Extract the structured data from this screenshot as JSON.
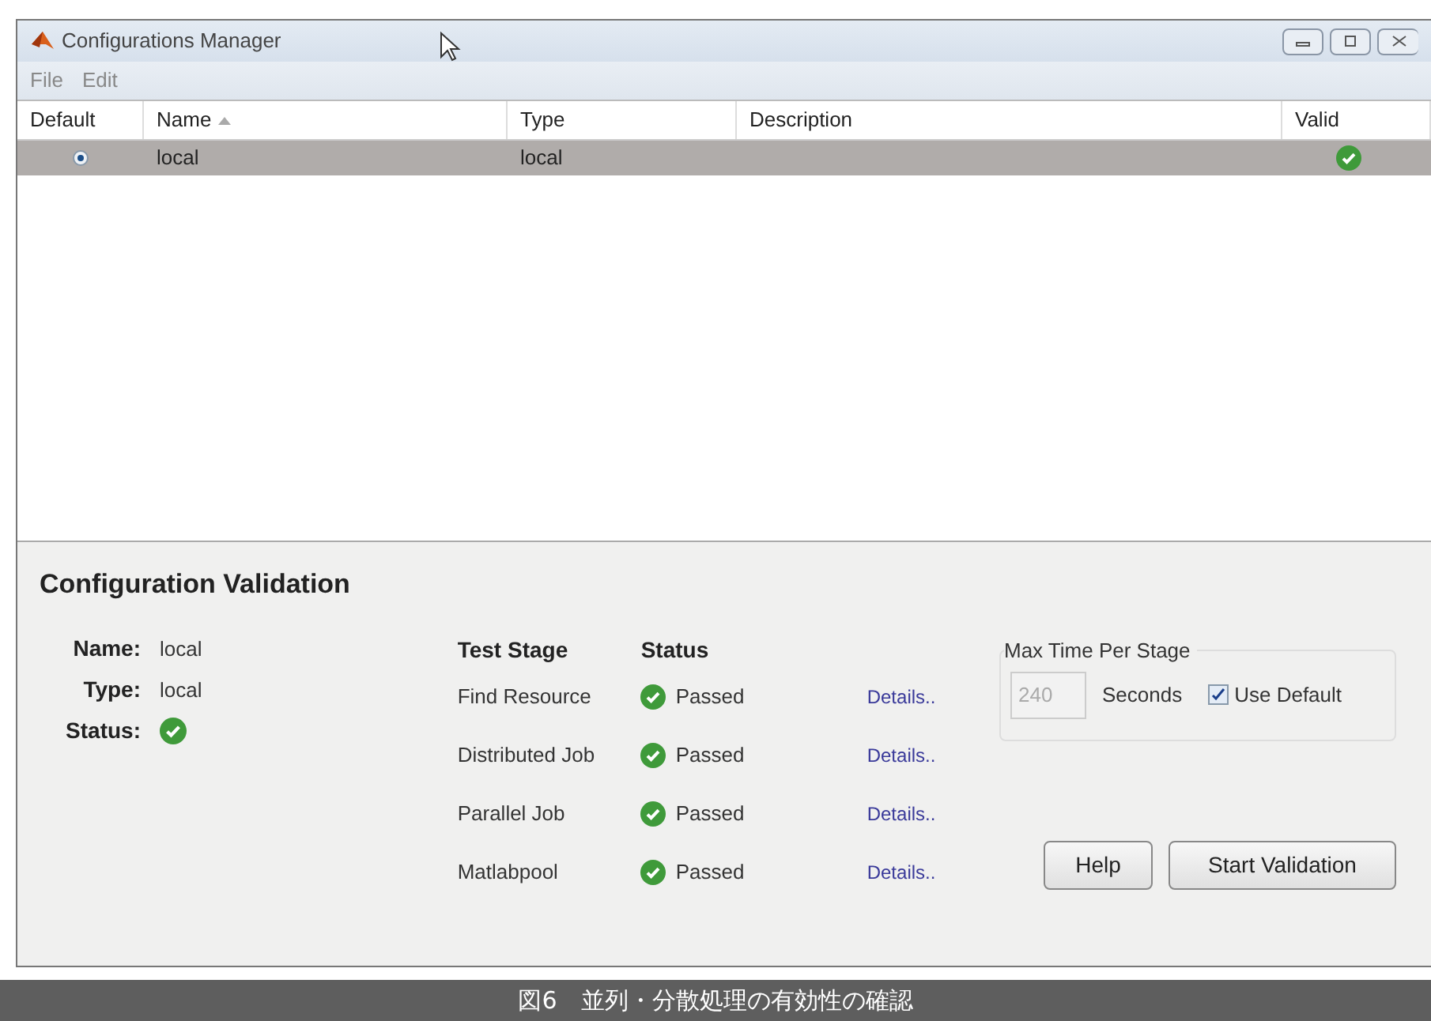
{
  "window": {
    "title": "Configurations Manager"
  },
  "menu": [
    "File",
    "Edit"
  ],
  "table": {
    "columns": [
      {
        "label": "Default",
        "sorted": false
      },
      {
        "label": "Name",
        "sorted": true
      },
      {
        "label": "Type",
        "sorted": false
      },
      {
        "label": "Description",
        "sorted": false
      },
      {
        "label": "Valid",
        "sorted": false
      }
    ],
    "rows": [
      {
        "default": true,
        "name": "local",
        "type": "local",
        "valid": true,
        "selected": true
      }
    ]
  },
  "validation": {
    "title": "Configuration Validation",
    "fields": [
      {
        "kind": "text",
        "label": "Name:",
        "value": "local"
      },
      {
        "kind": "text",
        "label": "Type:",
        "value": "local"
      },
      {
        "kind": "status",
        "label": "Status:",
        "passed": true
      }
    ],
    "stage_headers": [
      "Test Stage",
      "Status"
    ],
    "stages": [
      {
        "stage": "Find Resource",
        "passed": true,
        "status": "Passed",
        "link": "Details.."
      },
      {
        "stage": "Distributed Job",
        "passed": true,
        "status": "Passed",
        "link": "Details.."
      },
      {
        "stage": "Parallel Job",
        "passed": true,
        "status": "Passed",
        "link": "Details.."
      },
      {
        "stage": "Matlabpool",
        "passed": true,
        "status": "Passed",
        "link": "Details.."
      }
    ],
    "max_time": {
      "title": "Max Time Per Stage",
      "value": "240",
      "disabled": true,
      "unit": "Seconds",
      "use_default": {
        "label": "Use Default",
        "checked": true
      }
    },
    "buttons": [
      "Help",
      "Start Validation"
    ]
  },
  "caption": "図6　並列・分散処理の有効性の確認"
}
